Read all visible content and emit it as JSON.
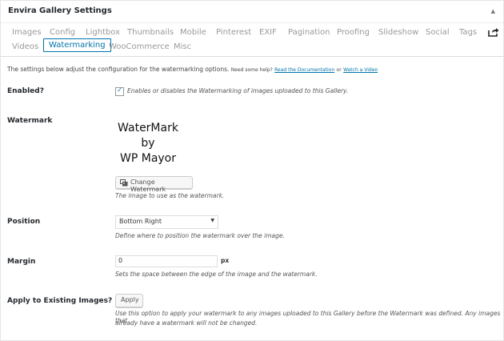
{
  "header": {
    "title": "Envira Gallery Settings",
    "toggle_icon": "triangle-up-icon"
  },
  "tabs": [
    {
      "label": "Images",
      "active": false
    },
    {
      "label": "Config",
      "active": false
    },
    {
      "label": "Lightbox",
      "active": false
    },
    {
      "label": "Thumbnails",
      "active": false
    },
    {
      "label": "Mobile",
      "active": false
    },
    {
      "label": "Pinterest",
      "active": false
    },
    {
      "label": "EXIF",
      "active": false
    },
    {
      "label": "Pagination",
      "active": false
    },
    {
      "label": "Proofing",
      "active": false
    },
    {
      "label": "Slideshow",
      "active": false
    },
    {
      "label": "Social",
      "active": false
    },
    {
      "label": "Tags",
      "active": false
    },
    {
      "label": "Videos",
      "active": false
    },
    {
      "label": "Watermarking",
      "active": true
    },
    {
      "label": "WooCommerce",
      "active": false
    },
    {
      "label": "Misc",
      "active": false
    }
  ],
  "intro": {
    "text": "The settings below adjust the configuration for the watermarking options.",
    "help": "Need some help?",
    "doc_link": "Read the Documentation",
    "or": "or",
    "video_link": "Watch a Video"
  },
  "enabled": {
    "label": "Enabled?",
    "checked": true,
    "description": "Enables or disables the Watermarking of images uploaded to this Gallery."
  },
  "watermark": {
    "label": "Watermark",
    "image_lines": [
      "WaterMark",
      "by",
      "WP Mayor"
    ],
    "change_button": "Change Watermark",
    "description": "The image to use as the watermark."
  },
  "position": {
    "label": "Position",
    "selected": "Bottom Right",
    "description": "Define where to position the watermark over the image."
  },
  "margin": {
    "label": "Margin",
    "value": "0",
    "unit": "px",
    "description": "Sets the space between the edge of the image and the watermark."
  },
  "apply": {
    "label": "Apply to Existing Images?",
    "button": "Apply",
    "description_line1": "Use this option to apply your watermark to any images uploaded to this Gallery before the Watermark was defined. Any images that",
    "description_line2": "already have a watermark will not be changed."
  }
}
